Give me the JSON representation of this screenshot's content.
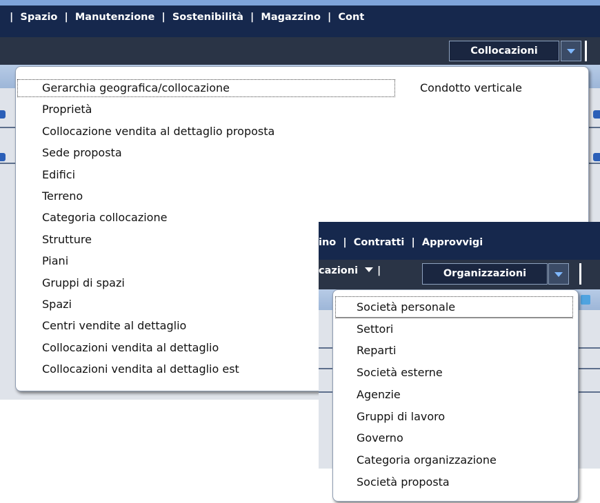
{
  "window1": {
    "nav_menu": "|  Spazio  |  Manutenzione  |  Sostenibilità  |  Magazzino  |  Cont",
    "active_menu": "Collocazioni",
    "dropdown": {
      "items": [
        "Gerarchia geografica/collocazione",
        "Proprietà",
        "Collocazione vendita al dettaglio proposta",
        "Sede proposta",
        "Edifici",
        "Terreno",
        "Categoria collocazione",
        "Strutture",
        "Piani",
        "Gruppi di spazi",
        "Spazi",
        "Centri vendite al dettaglio",
        "Collocazioni vendita al dettaglio",
        "Collocazioni vendita al dettaglio est"
      ],
      "right_item": "Condotto verticale"
    }
  },
  "window2": {
    "nav_menu": "ino  |  Contratti  |  Approvvigi",
    "sub_menu_left": "cazioni",
    "active_menu": "Organizzazioni",
    "dropdown": {
      "items": [
        "Società personale",
        "Settori",
        "Reparti",
        "Società esterne",
        "Agenzie",
        "Gruppi di lavoro",
        "Governo",
        "Categoria organizzazione",
        "Società proposta"
      ]
    }
  },
  "colors": {
    "nav_bg": "#16284d",
    "menu_border": "#8f9db2"
  }
}
